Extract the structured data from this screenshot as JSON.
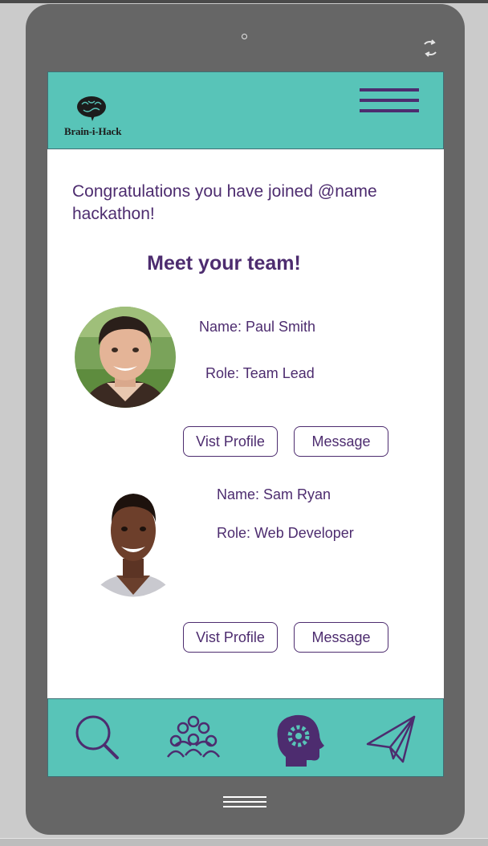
{
  "app": {
    "logo_text": "Brain-i-Hack"
  },
  "intro": {
    "congrats": "Congratulations you have joined @name hackathon!",
    "heading": "Meet your team!"
  },
  "team": [
    {
      "name": "Name: Paul Smith",
      "role": "Role: Team Lead",
      "profile_button": "Vist Profile",
      "message_button": "Message"
    },
    {
      "name": "Name: Sam Ryan",
      "role": "Role: Web Developer",
      "profile_button": "Vist Profile",
      "message_button": "Message"
    }
  ],
  "bottom_nav": {
    "items": [
      {
        "icon": "search-icon"
      },
      {
        "icon": "team-icon"
      },
      {
        "icon": "brain-gear-icon",
        "active": true
      },
      {
        "icon": "send-icon"
      }
    ]
  },
  "colors": {
    "teal": "#58c4b8",
    "purple": "#4d2c6f",
    "device": "#666666"
  }
}
